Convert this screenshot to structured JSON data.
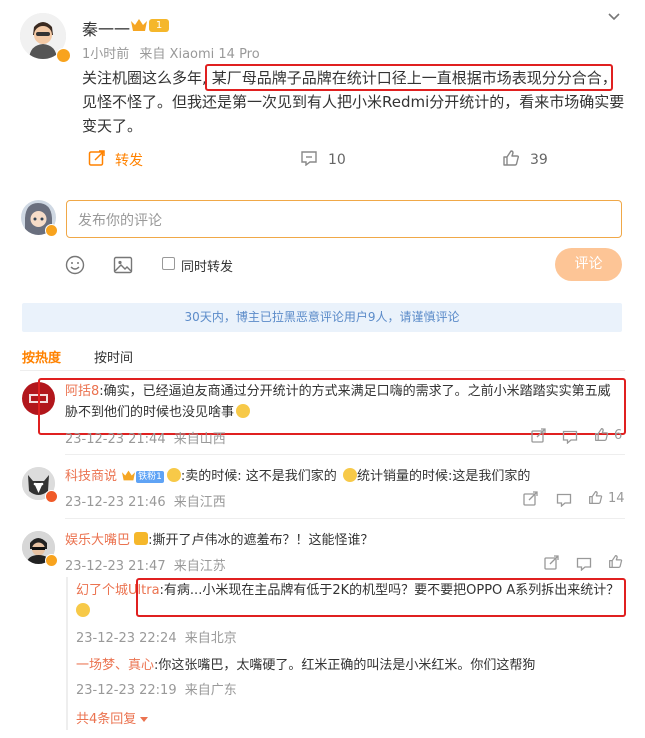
{
  "post": {
    "author": "秦一一",
    "level_badge": "1",
    "time": "1小时前",
    "source": "来自 Xiaomi 14 Pro",
    "text_before": "关注机圈这么多年,",
    "text_highlight": "某厂母品牌子品牌在统计口径上一直根据市场表现分分合合",
    "text_after": "，见怪不怪了。但我还是第一次见到有人把小米Redmi分开统计的，看来市场确实要变天了。",
    "repost_label": "转发",
    "comment_count": "10",
    "like_count": "39"
  },
  "composer": {
    "placeholder": "发布你的评论",
    "checkbox_label": "同时转发",
    "submit_label": "评论"
  },
  "notice": "30天内，博主已拉黑恶意评论用户9人，请谨慎评论",
  "sort_tabs": [
    "按热度",
    "按时间"
  ],
  "comments": [
    {
      "author": "阿括8",
      "text": ":确实，已经逼迫友商通过分开统计的方式来满足口嗨的需求了。之前小米踏踏实实第五威胁不到他们的时候也没见啥事",
      "time": "23-12-23 21:44",
      "location": "来自山西",
      "likes": "6"
    },
    {
      "author": "科技商说",
      "vip_badge": "铁粉1",
      "text": ":卖的时候: 这不是我们家的",
      "text2": "统计销量的时候:这是我们家的",
      "time": "23-12-23 21:46",
      "location": "来自江西",
      "likes": "14"
    },
    {
      "author": "娱乐大嘴巴",
      "text": ":撕开了卢伟冰的遮羞布？！这能怪谁？",
      "time": "23-12-23 21:47",
      "location": "来自江苏",
      "replies": [
        {
          "author": "幻了个城Ultra",
          "text": ":有病...小米现在主品牌有低于2K的机型吗？要不要把OPPO A系列拆出来统计？",
          "time": "23-12-23 22:24",
          "location": "来自北京"
        },
        {
          "author": "一场梦、真心",
          "text": ":你这张嘴巴，太嘴硬了。红米正确的叫法是小米红米。你们这帮狗",
          "time": "23-12-23 22:19",
          "location": "来自广东"
        }
      ],
      "more_replies": "共4条回复"
    }
  ],
  "colors": {
    "accent": "#ff8200",
    "highlight_box": "#e02020",
    "notice_bg": "#eaf2fb",
    "notice_text": "#5b8bc9"
  }
}
